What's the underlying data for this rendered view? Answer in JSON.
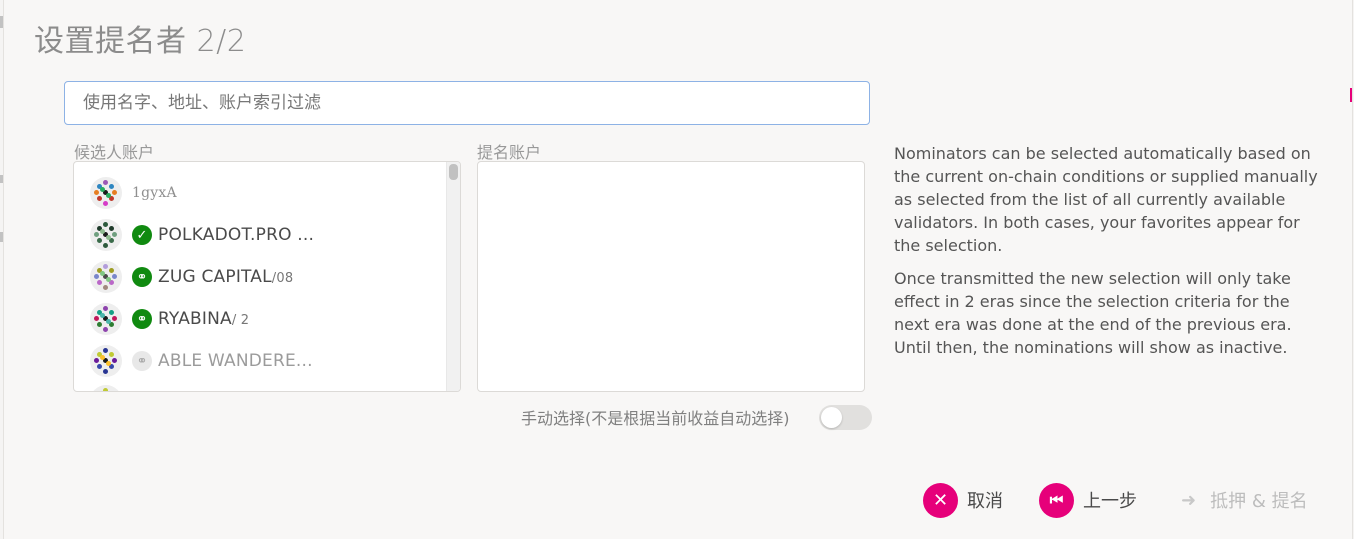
{
  "modal": {
    "title": "设置提名者 2/2"
  },
  "filter": {
    "placeholder": "使用名字、地址、账户索引过滤"
  },
  "candidates": {
    "label": "候选人账户",
    "items": [
      {
        "name": "1gyxA",
        "sub": "",
        "badge": "none",
        "icon": "identicon"
      },
      {
        "name": "POLKADOT.PRO ...",
        "sub": "",
        "badge": "verified-check-icon",
        "icon": "identicon"
      },
      {
        "name": "ZUG CAPITAL",
        "sub": "/08",
        "badge": "link-icon",
        "icon": "identicon"
      },
      {
        "name": "RYABINA",
        "sub": "/ 2",
        "badge": "link-icon",
        "icon": "identicon"
      },
      {
        "name": "ABLE WANDERE...",
        "sub": "",
        "badge": "link-icon-grey",
        "icon": "identicon"
      }
    ]
  },
  "nominated": {
    "label": "提名账户"
  },
  "info": {
    "p1": "Nominators can be selected automatically based on the current on-chain conditions or supplied manually as selected from the list of all currently available validators. In both cases, your favorites appear for the selection.",
    "p2": "Once transmitted the new selection will only take effect in 2 eras since the selection criteria for the next era was done at the end of the previous era. Until then, the nominations will show as inactive."
  },
  "manual_select": {
    "label": "手动选择(不是根据当前收益自动选择)",
    "enabled": false
  },
  "actions": {
    "cancel": "取消",
    "back": "上一步",
    "bond_nominate": "抵押 & 提名"
  },
  "colors": {
    "accent": "#e6007a",
    "verified": "#108a10",
    "focus_border": "#8db2e5"
  }
}
